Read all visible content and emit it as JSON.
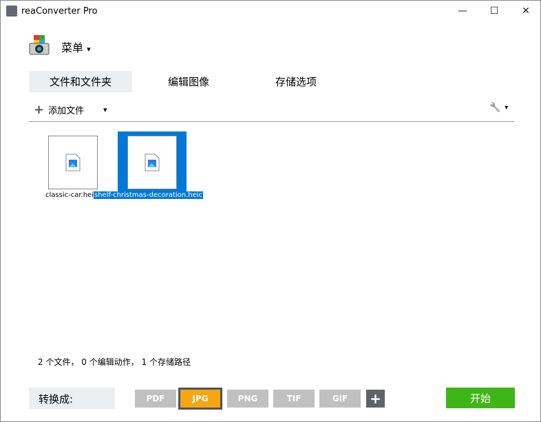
{
  "window": {
    "title": "reaConverter Pro",
    "minimize": "—",
    "maximize": "☐",
    "close": "✕"
  },
  "menu": {
    "label": "菜单",
    "arrow": "▾"
  },
  "tabs": [
    {
      "label": "文件和文件夹"
    },
    {
      "label": "编辑图像"
    },
    {
      "label": "存储选项"
    }
  ],
  "toolbar": {
    "add_icon": "+",
    "add_label": "添加文件",
    "arrow": "▾",
    "wrench": "🔧"
  },
  "files": [
    {
      "name": "classic-car.heic",
      "selected": false
    },
    {
      "name": "shelf-christmas-decoration.heic",
      "selected": true
    }
  ],
  "status": "2 个文件， 0 个编辑动作， 1 个存储路径",
  "convert": {
    "label": "转换成:",
    "formats": [
      "PDF",
      "JPG",
      "PNG",
      "TIF",
      "GIF"
    ],
    "selected": "JPG",
    "add": "+"
  },
  "start": "开始",
  "colors": {
    "accent": "#0078d7",
    "selected_format": "#f5a612",
    "start": "#3fb618"
  }
}
